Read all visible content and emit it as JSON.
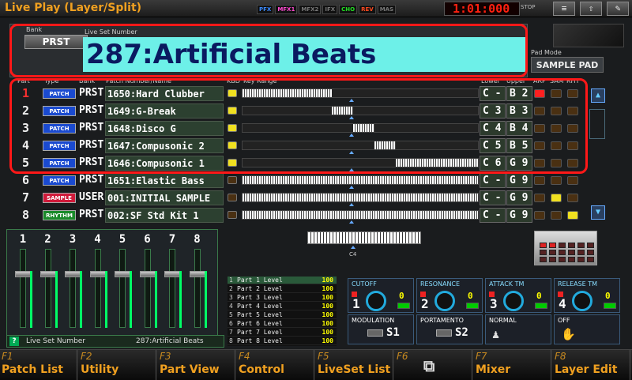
{
  "window": {
    "title": "Live Play (Layer/Split)"
  },
  "fx": [
    {
      "label": "PFX",
      "color": "#3a8aff"
    },
    {
      "label": "MFX1",
      "color": "#ff4ad0"
    },
    {
      "label": "MFX2",
      "color": "#777777"
    },
    {
      "label": "IFX",
      "color": "#777777"
    },
    {
      "label": "CHO",
      "color": "#22e022"
    },
    {
      "label": "REV",
      "color": "#ff4a20"
    },
    {
      "label": "MAS",
      "color": "#777777"
    }
  ],
  "clock": {
    "time": "1:01:000",
    "state": "STOP"
  },
  "toolbar": {
    "menu_icon": "≡",
    "up_icon": "⇧",
    "write_icon": "✎"
  },
  "liveset": {
    "bank_label": "Bank",
    "bank": "PRST",
    "number_label": "Live Set Number",
    "name": "287:Artificial Beats",
    "pad_mode_label": "Pad Mode",
    "pad_mode": "SAMPLE PAD"
  },
  "columns": {
    "part": "Part",
    "type": "Type",
    "bank": "Bank",
    "patch": "Patch Number/Name",
    "kbd": "KBD",
    "range": "Key Range",
    "lower": "Lower",
    "upper": "Upper",
    "arp": "ARP",
    "sam": "SAM",
    "rhy": "RHY"
  },
  "parts": [
    {
      "num": "1",
      "type": "PATCH",
      "type_color": "#1a4ad0",
      "bank": "PRST",
      "name": "1650:Hard Clubber",
      "kbd": "on",
      "low": "C -",
      "high": "B 2",
      "range": [
        0,
        0.38
      ],
      "arp": "on",
      "sam": "off",
      "rhy": "off",
      "selected": true
    },
    {
      "num": "2",
      "type": "PATCH",
      "type_color": "#1a4ad0",
      "bank": "PRST",
      "name": "1649:G-Break",
      "kbd": "on",
      "low": "C 3",
      "high": "B 3",
      "range": [
        0.38,
        0.47
      ],
      "arp": "off",
      "sam": "off",
      "rhy": "off"
    },
    {
      "num": "3",
      "type": "PATCH",
      "type_color": "#1a4ad0",
      "bank": "PRST",
      "name": "1648:Disco G",
      "kbd": "on",
      "low": "C 4",
      "high": "B 4",
      "range": [
        0.47,
        0.56
      ],
      "arp": "off",
      "sam": "off",
      "rhy": "off"
    },
    {
      "num": "4",
      "type": "PATCH",
      "type_color": "#1a4ad0",
      "bank": "PRST",
      "name": "1647:Compusonic 2",
      "kbd": "on",
      "low": "C 5",
      "high": "B 5",
      "range": [
        0.56,
        0.65
      ],
      "arp": "off",
      "sam": "off",
      "rhy": "off"
    },
    {
      "num": "5",
      "type": "PATCH",
      "type_color": "#1a4ad0",
      "bank": "PRST",
      "name": "1646:Compusonic 1",
      "kbd": "on",
      "low": "C 6",
      "high": "G 9",
      "range": [
        0.65,
        1.0
      ],
      "arp": "off",
      "sam": "off",
      "rhy": "off"
    },
    {
      "num": "6",
      "type": "PATCH",
      "type_color": "#1a4ad0",
      "bank": "PRST",
      "name": "1651:Elastic Bass",
      "kbd": "off",
      "low": "C -",
      "high": "G 9",
      "range": [
        0,
        1.0
      ],
      "arp": "off",
      "sam": "off",
      "rhy": "off"
    },
    {
      "num": "7",
      "type": "SAMPLE",
      "type_color": "#d01a3a",
      "bank": "USER",
      "name": "001:INITIAL SAMPLE",
      "kbd": "off",
      "low": "C -",
      "high": "G 9",
      "range": [
        0,
        1.0
      ],
      "arp": "off",
      "sam": "y",
      "rhy": "off"
    },
    {
      "num": "8",
      "type": "RHYTHM",
      "type_color": "#1a8a2a",
      "bank": "PRST",
      "name": "002:SF Std Kit 1",
      "kbd": "off",
      "low": "C -",
      "high": "G 9",
      "range": [
        0,
        1.0
      ],
      "arp": "off",
      "sam": "off",
      "rhy": "y"
    }
  ],
  "mixer": {
    "channels": [
      {
        "num": "1",
        "level": 0.72
      },
      {
        "num": "2",
        "level": 0.72
      },
      {
        "num": "3",
        "level": 0.72
      },
      {
        "num": "4",
        "level": 0.72
      },
      {
        "num": "5",
        "level": 0.72
      },
      {
        "num": "6",
        "level": 0.72
      },
      {
        "num": "7",
        "level": 0.72
      },
      {
        "num": "8",
        "level": 0.72
      }
    ]
  },
  "status": {
    "help": "?",
    "label": "Live Set Number",
    "value": "287:Artificial Beats"
  },
  "keyboard": {
    "note": "C4"
  },
  "levels": [
    {
      "n": "1",
      "name": "Part 1 Level",
      "val": "100"
    },
    {
      "n": "2",
      "name": "Part 2 Level",
      "val": "100"
    },
    {
      "n": "3",
      "name": "Part 3 Level",
      "val": "100"
    },
    {
      "n": "4",
      "name": "Part 4 Level",
      "val": "100"
    },
    {
      "n": "5",
      "name": "Part 5 Level",
      "val": "100"
    },
    {
      "n": "6",
      "name": "Part 6 Level",
      "val": "100"
    },
    {
      "n": "7",
      "name": "Part 7 Level",
      "val": "100"
    },
    {
      "n": "8",
      "name": "Part 8 Level",
      "val": "100"
    }
  ],
  "controls": [
    {
      "label": "CUTOFF",
      "num": "1",
      "val": "0"
    },
    {
      "label": "RESONANCE",
      "num": "2",
      "val": "0"
    },
    {
      "label": "ATTACK TM",
      "num": "3",
      "val": "0"
    },
    {
      "label": "RELEASE TM",
      "num": "4",
      "val": "0"
    }
  ],
  "switches": [
    {
      "label": "MODULATION",
      "name": "S1"
    },
    {
      "label": "PORTAMENTO",
      "name": "S2"
    },
    {
      "label": "NORMAL",
      "name": "",
      "icon": "♟"
    },
    {
      "label": "OFF",
      "name": "",
      "icon": "✋"
    }
  ],
  "fkeys": [
    {
      "f": "F1",
      "label": "Patch List"
    },
    {
      "f": "F2",
      "label": "Utility"
    },
    {
      "f": "F3",
      "label": "Part View"
    },
    {
      "f": "F4",
      "label": "Control"
    },
    {
      "f": "F5",
      "label": "LiveSet List"
    },
    {
      "f": "F6",
      "label": "",
      "icon": "⧉"
    },
    {
      "f": "F7",
      "label": "Mixer"
    },
    {
      "f": "F8",
      "label": "Layer Edit"
    }
  ]
}
